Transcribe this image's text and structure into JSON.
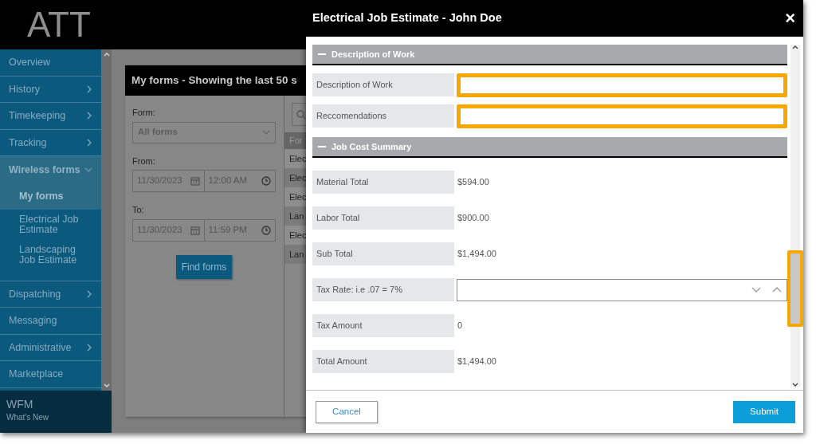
{
  "app": {
    "logo": "ATT"
  },
  "sidebar": {
    "items": [
      {
        "label": "Overview",
        "has_submenu": false,
        "expanded": false,
        "selected": false
      },
      {
        "label": "History",
        "has_submenu": true,
        "expanded": false,
        "selected": false
      },
      {
        "label": "Timekeeping",
        "has_submenu": true,
        "expanded": false,
        "selected": false
      },
      {
        "label": "Tracking",
        "has_submenu": true,
        "expanded": false,
        "selected": false
      },
      {
        "label": "Wireless forms",
        "has_submenu": true,
        "expanded": true,
        "selected": false,
        "children": [
          {
            "label": "My forms",
            "selected": true
          },
          {
            "label": "Electrical Job Estimate",
            "selected": false
          },
          {
            "label": "Landscaping Job Estimate",
            "selected": false
          }
        ]
      },
      {
        "label": "Dispatching",
        "has_submenu": true,
        "expanded": false,
        "selected": false
      },
      {
        "label": "Messaging",
        "has_submenu": false,
        "expanded": false,
        "selected": false
      },
      {
        "label": "Administrative",
        "has_submenu": true,
        "expanded": false,
        "selected": false
      },
      {
        "label": "Marketplace",
        "has_submenu": false,
        "expanded": false,
        "selected": false
      }
    ],
    "footer": {
      "title": "WFM",
      "subtitle": "What's New"
    }
  },
  "forms_panel": {
    "title": "My forms - Showing the last 50 s",
    "form_label": "Form:",
    "form_value": "All forms",
    "from_label": "From:",
    "from_date": "11/30/2023",
    "from_time": "12:00 AM",
    "to_label": "To:",
    "to_date": "11/30/2023",
    "to_time": "11:59 PM",
    "find_button": "Find forms",
    "table": {
      "column_1": "For",
      "rows": [
        "Elec",
        "Elec",
        "Elec",
        "Lan",
        "Elec",
        "Lan"
      ]
    }
  },
  "modal": {
    "title": "Electrical Job Estimate - John Doe",
    "close": "×",
    "sections": [
      {
        "title": "Description of Work",
        "expanded": true,
        "fields": [
          {
            "label": "Description of Work",
            "kind": "input",
            "highlighted": true
          },
          {
            "label": "Reccomendations",
            "kind": "input",
            "highlighted": true
          }
        ]
      },
      {
        "title": "Job Cost Summary",
        "expanded": true,
        "fields": [
          {
            "label": "Material Total",
            "kind": "readonly",
            "value": "$594.00"
          },
          {
            "label": "Labor Total",
            "kind": "readonly",
            "value": "$900.00"
          },
          {
            "label": "Sub Total",
            "kind": "readonly",
            "value": "$1,494.00"
          },
          {
            "label": "Tax Rate: i.e .07 = 7%",
            "kind": "spinner",
            "highlighted": false
          },
          {
            "label": "Tax Amount",
            "kind": "readonly",
            "value": "0"
          },
          {
            "label": "Total Amount",
            "kind": "readonly",
            "value": "$1,494.00"
          }
        ]
      }
    ],
    "scrollbar_highlighted": true,
    "buttons": [
      {
        "label": "Cancel",
        "kind": "secondary"
      },
      {
        "label": "Submit",
        "kind": "primary"
      }
    ]
  }
}
